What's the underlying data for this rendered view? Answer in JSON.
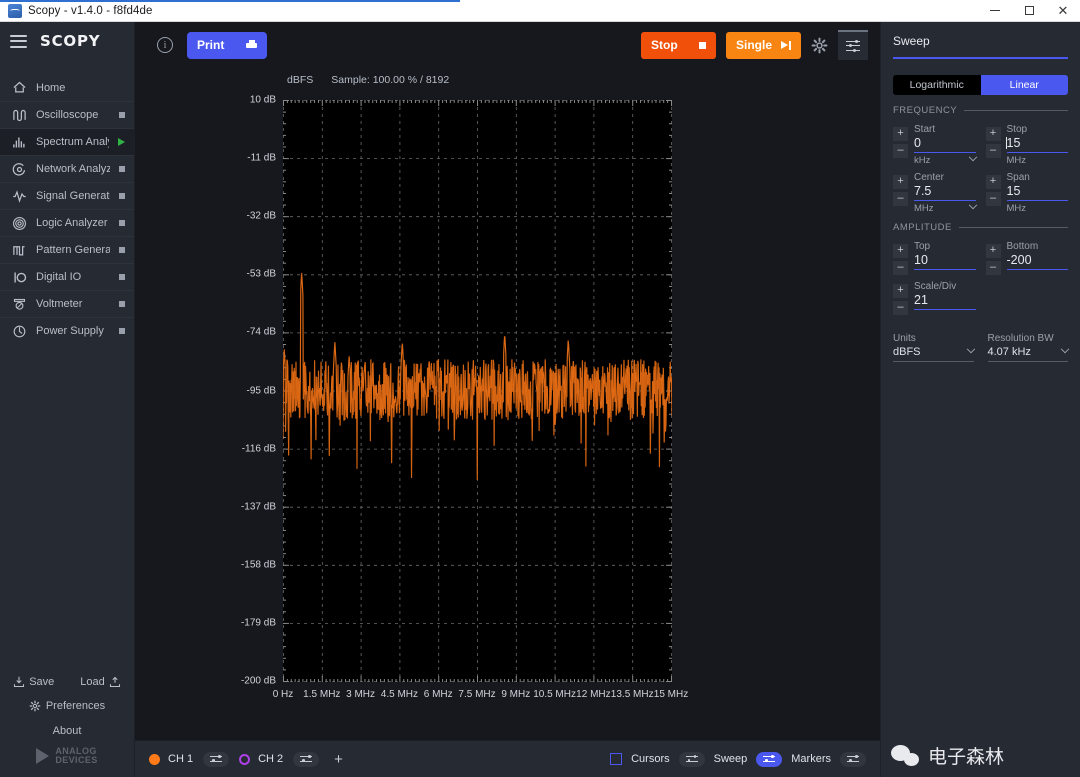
{
  "window": {
    "title": "Scopy - v1.4.0 - f8fd4de",
    "minimize": "–",
    "maximize": "▢",
    "close": "✕"
  },
  "sidebar": {
    "brand": "SCOPY",
    "items": [
      {
        "label": "Home",
        "icon": "home-icon",
        "marker": "none",
        "active": false
      },
      {
        "label": "Oscilloscope",
        "icon": "oscilloscope-icon",
        "marker": "square",
        "active": false
      },
      {
        "label": "Spectrum Analyzer",
        "icon": "spectrum-icon",
        "marker": "play",
        "active": true
      },
      {
        "label": "Network Analyzer",
        "icon": "network-icon",
        "marker": "square",
        "active": false
      },
      {
        "label": "Signal Generator",
        "icon": "signal-generator-icon",
        "marker": "square",
        "active": false
      },
      {
        "label": "Logic Analyzer",
        "icon": "logic-analyzer-icon",
        "marker": "square",
        "active": false
      },
      {
        "label": "Pattern Generator",
        "icon": "pattern-generator-icon",
        "marker": "square",
        "active": false
      },
      {
        "label": "Digital IO",
        "icon": "digital-io-icon",
        "marker": "square",
        "active": false
      },
      {
        "label": "Voltmeter",
        "icon": "voltmeter-icon",
        "marker": "square",
        "active": false
      },
      {
        "label": "Power Supply",
        "icon": "power-supply-icon",
        "marker": "square",
        "active": false
      }
    ],
    "footer": {
      "save": "Save",
      "load": "Load",
      "preferences": "Preferences",
      "about": "About",
      "logo_line1": "ANALOG",
      "logo_line2": "DEVICES"
    }
  },
  "toolbar": {
    "info": "i",
    "print": "Print",
    "stop": "Stop",
    "single": "Single"
  },
  "plot": {
    "units_label": "dBFS",
    "sample_label": "Sample: 100.00 % / 8192"
  },
  "channels": {
    "ch1": {
      "label": "CH 1",
      "color": "#ff7a18",
      "settings_on": false
    },
    "ch2": {
      "label": "CH 2",
      "color": "#b040e8",
      "settings_on": false
    },
    "add": "+",
    "cursors": "Cursors",
    "sweep": "Sweep",
    "markers": "Markers",
    "sweep_on": true
  },
  "rpanel": {
    "title": "Sweep",
    "scale_log": "Logarithmic",
    "scale_linear": "Linear",
    "frequency_header": "FREQUENCY",
    "amplitude_header": "AMPLITUDE",
    "start": {
      "label": "Start",
      "value": "0",
      "unit": "kHz",
      "has_dropdown": true
    },
    "stop": {
      "label": "Stop",
      "value": "15",
      "unit": "MHz",
      "has_dropdown": false
    },
    "center": {
      "label": "Center",
      "value": "7.5",
      "unit": "MHz",
      "has_dropdown": true
    },
    "span": {
      "label": "Span",
      "value": "15",
      "unit": "MHz",
      "has_dropdown": false
    },
    "top": {
      "label": "Top",
      "value": "10"
    },
    "bottom": {
      "label": "Bottom",
      "value": "-200"
    },
    "scale_div": {
      "label": "Scale/Div",
      "value": "21"
    },
    "units": {
      "label": "Units",
      "value": "dBFS"
    },
    "resolution_bw": {
      "label": "Resolution BW",
      "value": "4.07 kHz"
    },
    "plus": "+",
    "minus": "–",
    "watermark": "电子森林"
  },
  "chart_data": {
    "type": "line",
    "title": "",
    "xlabel": "",
    "ylabel": "dBFS",
    "xlim": [
      0,
      15
    ],
    "ylim": [
      -200,
      10
    ],
    "x_unit": "MHz",
    "y_unit": "dB",
    "grid": true,
    "trace_color": "#ff7a18",
    "x_ticks": [
      "0 Hz",
      "1.5 MHz",
      "3 MHz",
      "4.5 MHz",
      "6 MHz",
      "7.5 MHz",
      "9 MHz",
      "10.5 MHz",
      "12 MHz",
      "13.5 MHz",
      "15 MHz"
    ],
    "y_ticks": [
      "10 dB",
      "-11 dB",
      "-32 dB",
      "-53 dB",
      "-74 dB",
      "-95 dB",
      "-116 dB",
      "-137 dB",
      "-158 dB",
      "-179 dB",
      "-200 dB"
    ],
    "noise_floor_db": -95,
    "noise_span_db": 22,
    "peaks": [
      {
        "freq_mhz": 0.05,
        "level_db": -80
      },
      {
        "freq_mhz": 0.72,
        "level_db": -52
      },
      {
        "freq_mhz": 2.0,
        "level_db": -77
      },
      {
        "freq_mhz": 2.55,
        "level_db": -82
      },
      {
        "freq_mhz": 3.15,
        "level_db": -85
      },
      {
        "freq_mhz": 4.6,
        "level_db": -77
      },
      {
        "freq_mhz": 5.3,
        "level_db": -87
      },
      {
        "freq_mhz": 6.3,
        "level_db": -88
      },
      {
        "freq_mhz": 7.4,
        "level_db": -89
      },
      {
        "freq_mhz": 8.55,
        "level_db": -74
      },
      {
        "freq_mhz": 9.7,
        "level_db": -84
      },
      {
        "freq_mhz": 11.0,
        "level_db": -76
      },
      {
        "freq_mhz": 12.4,
        "level_db": -88
      },
      {
        "freq_mhz": 13.6,
        "level_db": -89
      }
    ]
  }
}
